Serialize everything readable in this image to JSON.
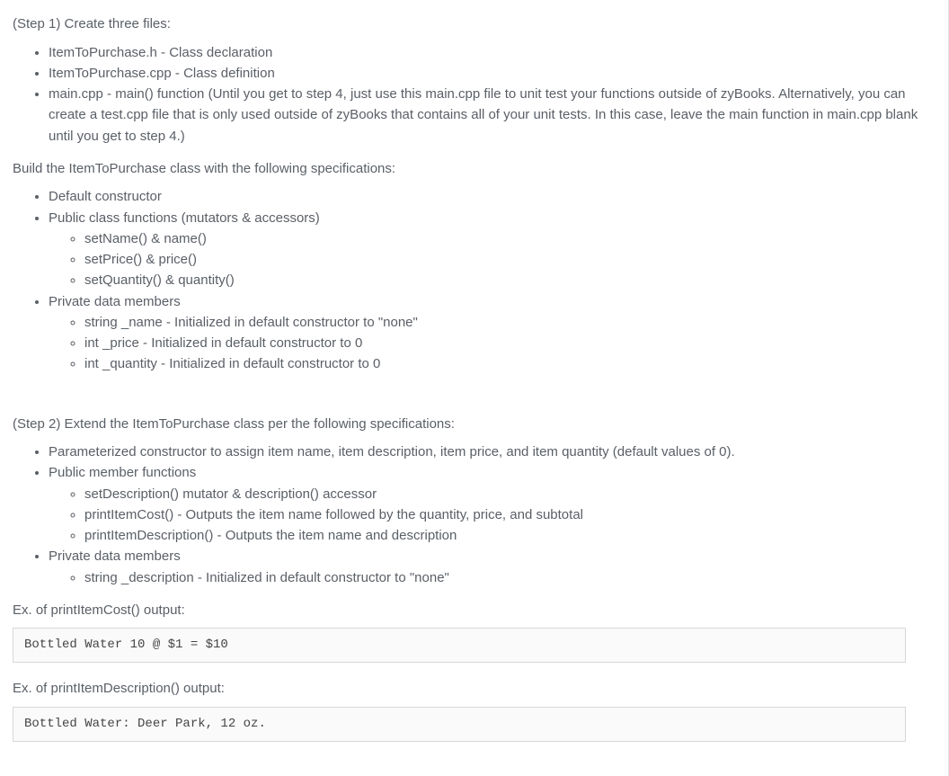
{
  "step1": {
    "intro": "(Step 1) Create three files:",
    "files": [
      "ItemToPurchase.h - Class declaration",
      "ItemToPurchase.cpp - Class definition",
      "main.cpp - main() function (Until you get to step 4, just use this main.cpp file to unit test your functions outside of zyBooks. Alternatively, you can create a test.cpp file that is only used outside of zyBooks that contains all of your unit tests. In this case, leave the main function in main.cpp blank until you get to step 4.)"
    ],
    "build_intro": "Build the ItemToPurchase class with the following specifications:",
    "specs": [
      {
        "label": "Default constructor",
        "sub": []
      },
      {
        "label": "Public class functions (mutators & accessors)",
        "sub": [
          "setName() & name()",
          "setPrice() & price()",
          "setQuantity() & quantity()"
        ]
      },
      {
        "label": "Private data members",
        "sub": [
          "string _name - Initialized in default constructor to \"none\"",
          "int _price - Initialized in default constructor to 0",
          "int _quantity - Initialized in default constructor to 0"
        ]
      }
    ]
  },
  "step2": {
    "intro": "(Step 2) Extend the ItemToPurchase class per the following specifications:",
    "specs": [
      {
        "label": "Parameterized constructor to assign item name, item description, item price, and item quantity (default values of 0).",
        "sub": []
      },
      {
        "label": "Public member functions",
        "sub": [
          "setDescription() mutator & description() accessor",
          "printItemCost() - Outputs the item name followed by the quantity, price, and subtotal",
          "printItemDescription() - Outputs the item name and description"
        ]
      },
      {
        "label": "Private data members",
        "sub": [
          "string _description - Initialized in default constructor to \"none\""
        ]
      }
    ],
    "ex_cost_label": "Ex. of printItemCost() output:",
    "ex_cost_code": "Bottled Water 10 @ $1 = $10",
    "ex_desc_label": "Ex. of printItemDescription() output:",
    "ex_desc_code": "Bottled Water: Deer Park, 12 oz."
  }
}
